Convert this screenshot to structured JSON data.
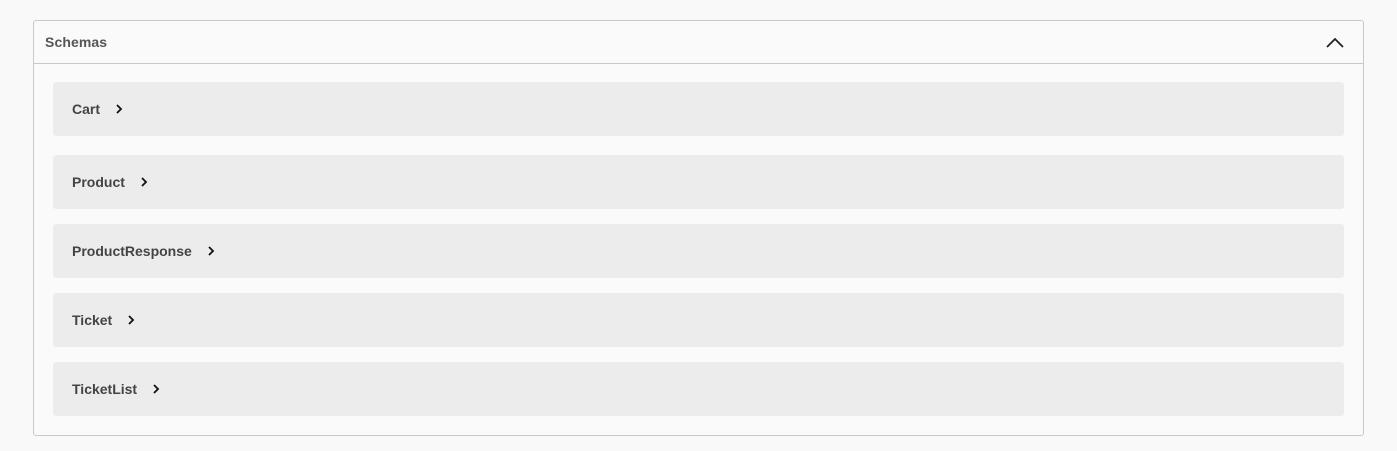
{
  "panel": {
    "title": "Schemas",
    "toggle_icon": "chevron-up-icon"
  },
  "models": [
    {
      "name": "Cart",
      "icon": "chevron-right-icon"
    },
    {
      "name": "Product",
      "icon": "chevron-right-icon"
    },
    {
      "name": "ProductResponse",
      "icon": "chevron-right-icon"
    },
    {
      "name": "Ticket",
      "icon": "chevron-right-icon"
    },
    {
      "name": "TicketList",
      "icon": "chevron-right-icon"
    }
  ],
  "colors": {
    "background": "#f9f9f9",
    "row_background": "#ececec",
    "border": "#c8c8c8",
    "text": "#444444"
  }
}
